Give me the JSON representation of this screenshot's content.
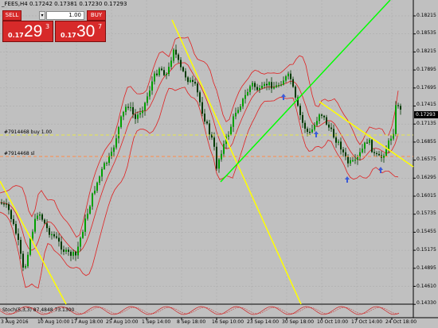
{
  "title": "_FEES,H4  0.17242 0.17381 0.17230 0.17293",
  "trade_panel": {
    "sell_label": "SELL",
    "buy_label": "BUY",
    "lot": "1.00",
    "sell_price_small": "0.17",
    "sell_price_big": "29",
    "sell_price_sup": "3",
    "buy_price_small": "0.17",
    "buy_price_big": "30",
    "buy_price_sup": "7"
  },
  "price_axis": [
    "0.18215",
    "0.18535",
    "0.18215",
    "0.17895",
    "0.17695",
    "0.17415",
    "0.17135",
    "0.16855",
    "0.16575",
    "0.16295",
    "0.16015",
    "0.15735",
    "0.15455",
    "0.15175",
    "0.14895",
    "0.14610",
    "0.14330"
  ],
  "current_price": "0.17293",
  "date_axis": [
    "3 Aug 2016",
    "10 Aug 10:00",
    "17 Aug 18:00",
    "25 Aug 10:00",
    "1 Sep 14:00",
    "8 Sep 18:00",
    "16 Sep 10:00",
    "23 Sep 14:00",
    "30 Sep 18:00",
    "10 Oct 10:00",
    "17 Oct 14:00",
    "24 Oct 18:00"
  ],
  "orders": {
    "buy_label": "#7914468 buy 1.00",
    "sl_label": "#7914468 sl"
  },
  "indicator_label": "Stoch(5,3,3) 87.4848 73.1300",
  "colors": {
    "background": "#c0c0c0",
    "candle": "#006400",
    "bollinger": "#ff0000",
    "trendline_yellow": "#ffff00",
    "trendline_green": "#00ff00",
    "buy_line": "#e8e84a",
    "sl_line": "#ff8c4a",
    "price_tag": "#000000"
  }
}
